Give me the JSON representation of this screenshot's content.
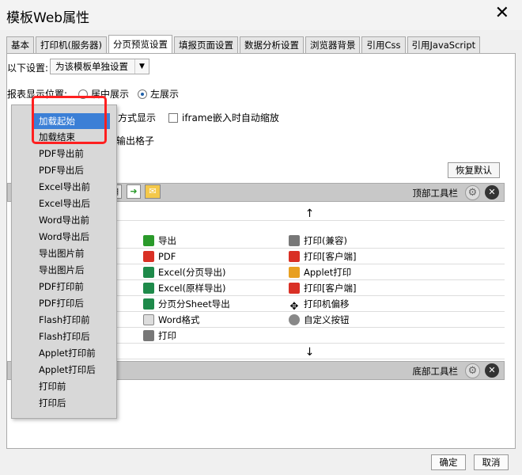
{
  "window": {
    "title": "模板Web属性",
    "close": "✕"
  },
  "tabs": [
    "基本",
    "打印机(服务器)",
    "分页预览设置",
    "填报页面设置",
    "数据分析设置",
    "浏览器背景",
    "引用Css",
    "引用JavaScript"
  ],
  "settings": {
    "following_label": "以下设置:",
    "following_value": "为该模板单独设置",
    "position_label": "报表显示位置:",
    "position_center": "居中展示",
    "position_left": "左展示",
    "display_mode": "方式显示",
    "iframe_scale": "iframe嵌入时自动缩放",
    "output_cells": "输出格子",
    "restore_default": "恢复默认"
  },
  "toolbars": {
    "top_label": "顶部工具栏",
    "bottom_label": "底部工具栏"
  },
  "grid": {
    "arrow_up": "↑",
    "arrow_down": "↓",
    "col2": [
      "导出",
      "PDF",
      "Excel(分页导出)",
      "Excel(原样导出)",
      "分页分Sheet导出",
      "Word格式",
      "打印"
    ],
    "col3": [
      "打印(兼容)",
      "打印[客户端]",
      "Applet打印",
      "打印[客户端]",
      "打印机偏移",
      "自定义按钮"
    ]
  },
  "event_menu": [
    "加载起始",
    "加载结束",
    "PDF导出前",
    "PDF导出后",
    "Excel导出前",
    "Excel导出后",
    "Word导出前",
    "Word导出后",
    "导出图片前",
    "导出图片后",
    "PDF打印前",
    "PDF打印后",
    "Flash打印前",
    "Flash打印后",
    "Applet打印前",
    "Applet打印后",
    "打印前",
    "打印后"
  ],
  "footer": {
    "ok": "确定",
    "cancel": "取消"
  },
  "colors": {
    "selection": "#3b7fd6",
    "highlight_box": "#ff2020"
  }
}
